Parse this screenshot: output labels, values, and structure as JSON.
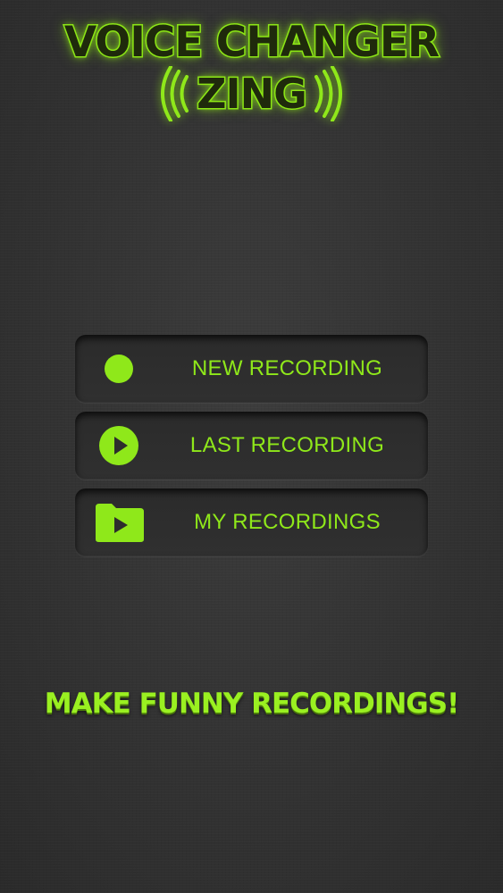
{
  "logo": {
    "title": "VOICE CHANGER",
    "subtitle": "ZING",
    "accent_color": "#8fe81a"
  },
  "menu": {
    "items": [
      {
        "label": "NEW RECORDING",
        "icon": "record-icon"
      },
      {
        "label": "LAST RECORDING",
        "icon": "play-circle-icon"
      },
      {
        "label": "MY RECORDINGS",
        "icon": "folder-play-icon"
      }
    ]
  },
  "tagline": "MAKE FUNNY RECORDINGS!"
}
